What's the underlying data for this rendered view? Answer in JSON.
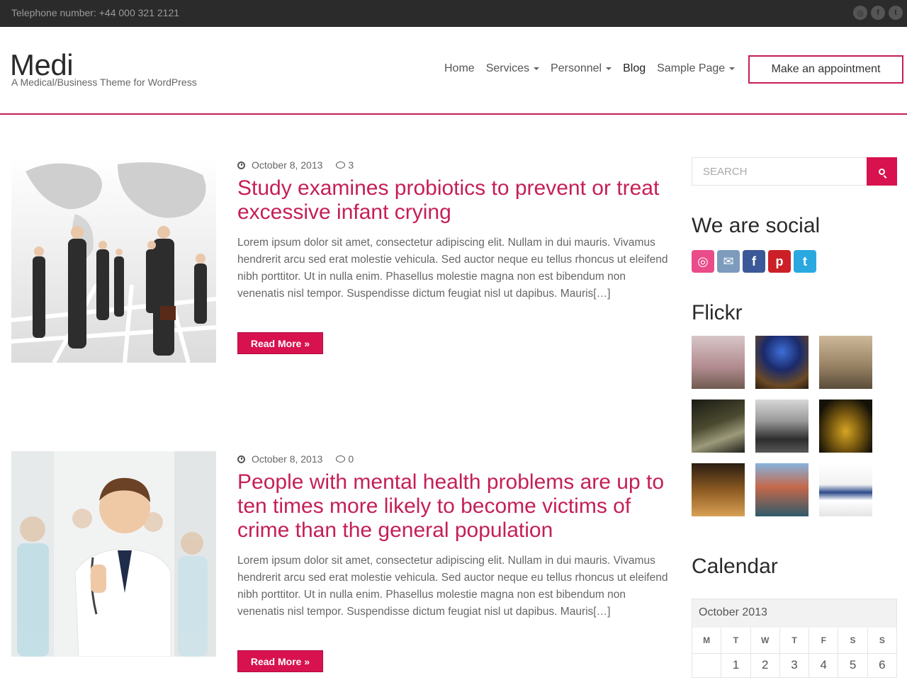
{
  "topbar": {
    "phone": "Telephone number: +44 000 321 2121",
    "social_icons": [
      "dribbble-icon",
      "facebook-icon",
      "twitter-icon"
    ]
  },
  "header": {
    "title": "Medi",
    "tagline": "A Medical/Business Theme for WordPress",
    "nav": [
      {
        "label": "Home",
        "has_dropdown": false
      },
      {
        "label": "Services",
        "has_dropdown": true
      },
      {
        "label": "Personnel",
        "has_dropdown": true
      },
      {
        "label": "Blog",
        "has_dropdown": false,
        "active": true
      },
      {
        "label": "Sample Page",
        "has_dropdown": true
      }
    ],
    "appointment_button": "Make an appointment"
  },
  "posts": [
    {
      "date": "October 8, 2013",
      "comments": "3",
      "title": "Study examines probiotics to prevent or treat excessive infant crying",
      "excerpt": "Lorem ipsum dolor sit amet, consectetur adipiscing elit. Nullam in dui mauris. Vivamus hendrerit arcu sed erat molestie vehicula. Sed auctor neque eu tellus rhoncus ut eleifend nibh porttitor. Ut in nulla enim. Phasellus molestie magna non est bibendum non venenatis nisl tempor. Suspendisse dictum feugiat nisl ut dapibus. Mauris[…]",
      "read_more": "Read More »"
    },
    {
      "date": "October 8, 2013",
      "comments": "0",
      "title": "People with mental health problems are up to ten times more likely to become victims of crime than the general population",
      "excerpt": "Lorem ipsum dolor sit amet, consectetur adipiscing elit. Nullam in dui mauris. Vivamus hendrerit arcu sed erat molestie vehicula. Sed auctor neque eu tellus rhoncus ut eleifend nibh porttitor. Ut in nulla enim. Phasellus molestie magna non est bibendum non venenatis nisl tempor. Suspendisse dictum feugiat nisl ut dapibus. Mauris[…]",
      "read_more": "Read More »"
    }
  ],
  "sidebar": {
    "search_placeholder": "SEARCH",
    "social_title": "We are social",
    "social_icons": [
      {
        "name": "dribbble-icon",
        "color": "#ea4c89",
        "glyph": "◎"
      },
      {
        "name": "email-icon",
        "color": "#6f8fb3",
        "glyph": "✉"
      },
      {
        "name": "facebook-icon",
        "color": "#3b5998",
        "glyph": "f"
      },
      {
        "name": "pinterest-icon",
        "color": "#cb2027",
        "glyph": "p"
      },
      {
        "name": "twitter-icon",
        "color": "#2aa9e0",
        "glyph": "t"
      }
    ],
    "flickr_title": "Flickr",
    "flickr_photos": [
      {
        "name": "flickr-photo-street"
      },
      {
        "name": "flickr-photo-arcade"
      },
      {
        "name": "flickr-photo-canal"
      },
      {
        "name": "flickr-photo-night-building"
      },
      {
        "name": "flickr-photo-sculpture"
      },
      {
        "name": "flickr-photo-eiffel-tower"
      },
      {
        "name": "flickr-photo-plaza"
      },
      {
        "name": "flickr-photo-venice"
      },
      {
        "name": "flickr-photo-tshirt"
      }
    ],
    "calendar_title": "Calendar",
    "calendar": {
      "caption": "October 2013",
      "weekdays": [
        "M",
        "T",
        "W",
        "T",
        "F",
        "S",
        "S"
      ],
      "first_row": [
        "",
        "1",
        "2",
        "3",
        "4",
        "5",
        "6"
      ]
    }
  },
  "colors": {
    "accent": "#c51f55",
    "button": "#d8124f",
    "topbar": "#2b2b2b"
  }
}
